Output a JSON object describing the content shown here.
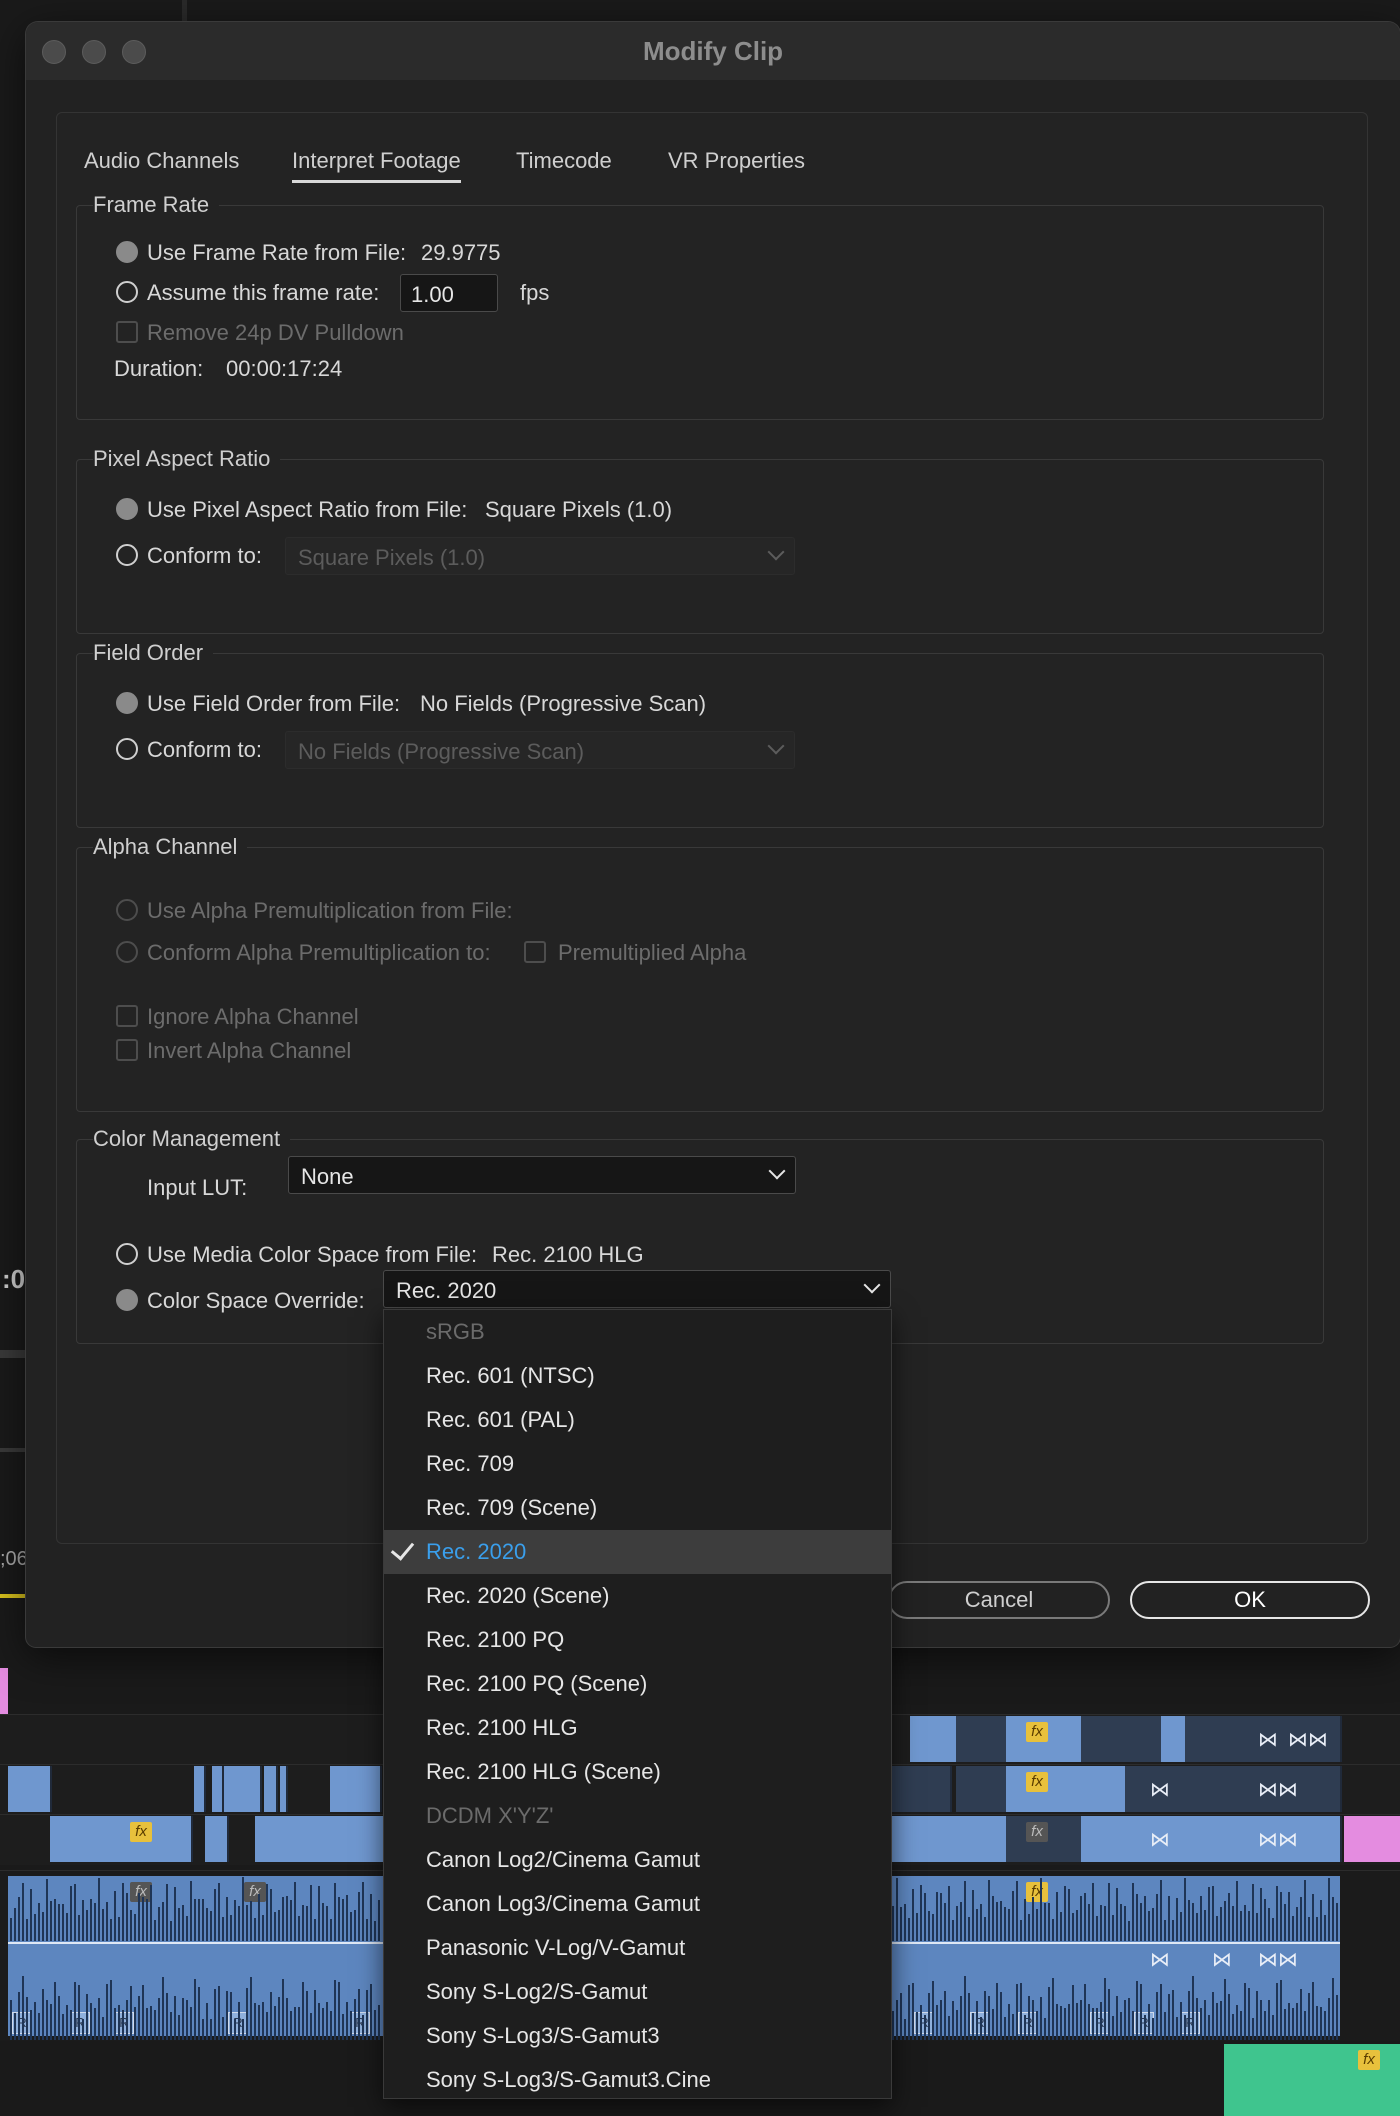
{
  "background": {
    "timecode_fragment_1": ":0",
    "timecode_fragment_2": ";06",
    "fx_label": "fx",
    "render_label": "R",
    "transition_glyph": "⋈",
    "double_transition_glyph": "⋈⋈"
  },
  "dialog": {
    "title": "Modify Clip",
    "tabs": [
      "Audio Channels",
      "Interpret Footage",
      "Timecode",
      "VR Properties"
    ],
    "active_tab": "Interpret Footage",
    "frame_rate": {
      "title": "Frame Rate",
      "use_from_file_label": "Use Frame Rate from File:",
      "use_from_file_value": "29.9775",
      "assume_label": "Assume this frame rate:",
      "assume_value": "1.00",
      "fps_label": "fps",
      "pulldown_label": "Remove 24p DV Pulldown",
      "duration_label": "Duration:",
      "duration_value": "00:00:17:24"
    },
    "pixel_aspect": {
      "title": "Pixel Aspect Ratio",
      "use_from_file_label": "Use Pixel Aspect Ratio from File:",
      "use_from_file_value": "Square Pixels (1.0)",
      "conform_label": "Conform to:",
      "conform_value": "Square Pixels (1.0)"
    },
    "field_order": {
      "title": "Field Order",
      "use_from_file_label": "Use Field Order from File:",
      "use_from_file_value": "No Fields (Progressive Scan)",
      "conform_label": "Conform to:",
      "conform_value": "No Fields (Progressive Scan)"
    },
    "alpha": {
      "title": "Alpha Channel",
      "use_premult_label": "Use Alpha Premultiplication from File:",
      "conform_premult_label": "Conform Alpha Premultiplication to:",
      "premultiplied_label": "Premultiplied Alpha",
      "ignore_label": "Ignore Alpha Channel",
      "invert_label": "Invert Alpha Channel"
    },
    "color": {
      "title": "Color Management",
      "input_lut_label": "Input LUT:",
      "input_lut_value": "None",
      "use_media_label": "Use Media Color Space from File:",
      "use_media_value": "Rec. 2100 HLG",
      "override_label": "Color Space Override:",
      "override_value": "Rec. 2020"
    },
    "buttons": {
      "cancel": "Cancel",
      "ok": "OK"
    }
  },
  "dropdown": {
    "items": [
      {
        "label": "sRGB",
        "disabled": true
      },
      {
        "label": "Rec. 601 (NTSC)"
      },
      {
        "label": "Rec. 601 (PAL)"
      },
      {
        "label": "Rec. 709"
      },
      {
        "label": "Rec. 709 (Scene)"
      },
      {
        "label": "Rec. 2020",
        "selected": true
      },
      {
        "label": "Rec. 2020 (Scene)"
      },
      {
        "label": "Rec. 2100 PQ"
      },
      {
        "label": "Rec. 2100 PQ (Scene)"
      },
      {
        "label": "Rec. 2100 HLG"
      },
      {
        "label": "Rec. 2100 HLG (Scene)"
      },
      {
        "label": "DCDM X'Y'Z'",
        "disabled": true
      },
      {
        "label": "Canon Log2/Cinema Gamut"
      },
      {
        "label": "Canon Log3/Cinema Gamut"
      },
      {
        "label": "Panasonic V-Log/V-Gamut"
      },
      {
        "label": "Sony S-Log2/S-Gamut"
      },
      {
        "label": "Sony S-Log3/S-Gamut3"
      },
      {
        "label": "Sony S-Log3/S-Gamut3.Cine"
      }
    ]
  },
  "colors": {
    "accent_selected": "#3a9fec",
    "clip_blue": "#6f97cf",
    "clip_pink": "#e48ce0",
    "clip_green": "#3fc58e",
    "fx_badge": "#e8c13c"
  }
}
